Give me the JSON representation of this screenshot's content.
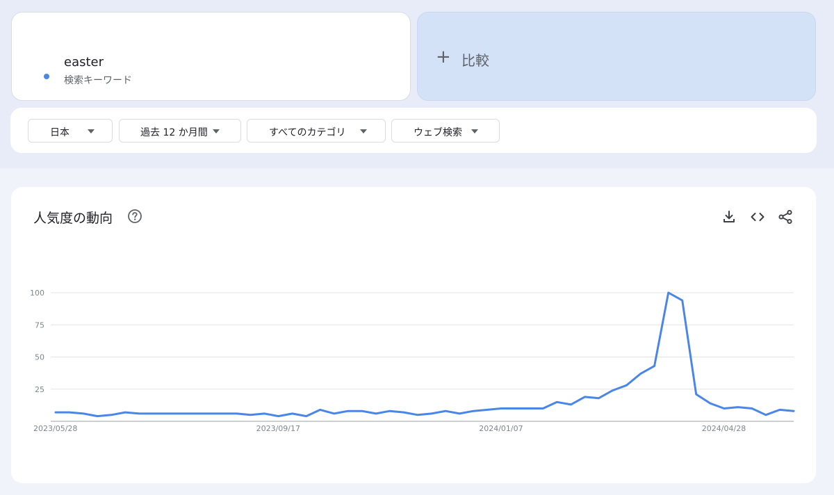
{
  "term": {
    "name": "easter",
    "subtitle": "検索キーワード",
    "color": "#4a86e8"
  },
  "compare": {
    "label": "比較",
    "icon": "plus-icon"
  },
  "filters": [
    {
      "label": "日本"
    },
    {
      "label": "過去 12 か月間"
    },
    {
      "label": "すべてのカテゴリ"
    },
    {
      "label": "ウェブ検索"
    }
  ],
  "chart": {
    "title": "人気度の動向",
    "icons": [
      "help-icon",
      "download-icon",
      "embed-icon",
      "share-icon"
    ]
  },
  "chart_data": {
    "type": "line",
    "title": "人気度の動向",
    "xlabel": "",
    "ylabel": "",
    "ylim": [
      0,
      100
    ],
    "yticks": [
      25,
      50,
      75,
      100
    ],
    "grid": true,
    "x_tick_labels": [
      {
        "label": "2023/05/28",
        "index": 0
      },
      {
        "label": "2023/09/17",
        "index": 16
      },
      {
        "label": "2024/01/07",
        "index": 32
      },
      {
        "label": "2024/04/28",
        "index": 48
      }
    ],
    "series": [
      {
        "color": "#4a86e8",
        "values": [
          7,
          7,
          6,
          4,
          5,
          7,
          6,
          6,
          6,
          6,
          6,
          6,
          6,
          6,
          5,
          6,
          4,
          6,
          4,
          9,
          6,
          8,
          8,
          6,
          8,
          7,
          5,
          6,
          8,
          6,
          8,
          9,
          10,
          10,
          10,
          10,
          15,
          13,
          19,
          18,
          24,
          28,
          37,
          43,
          100,
          94,
          21,
          14,
          10,
          11,
          10,
          5,
          9,
          8
        ]
      }
    ]
  }
}
